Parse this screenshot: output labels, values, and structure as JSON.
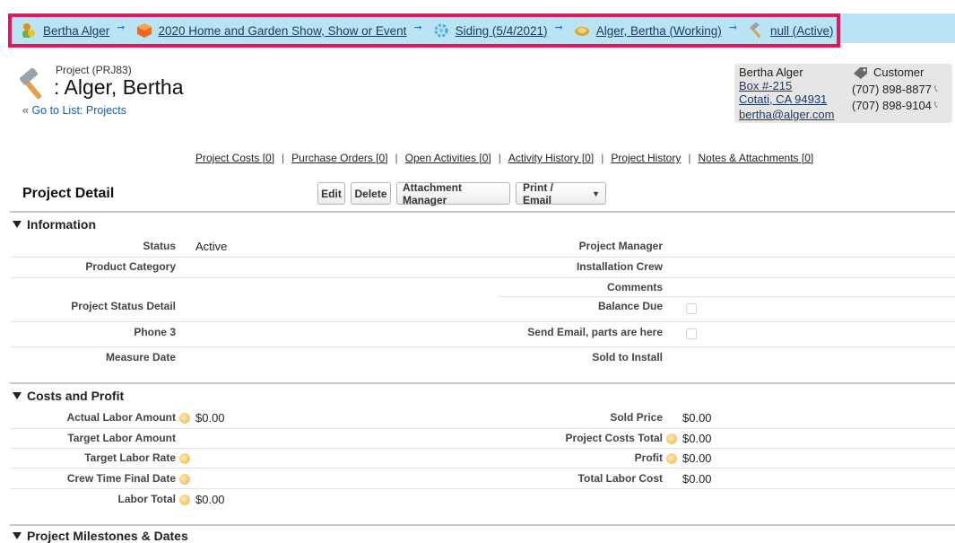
{
  "breadcrumbs": [
    {
      "label": "Bertha Alger",
      "icon": "contact-icon",
      "color": "#e88a1a"
    },
    {
      "label": "2020 Home and Garden Show, Show or Event",
      "icon": "box-icon",
      "color": "#f26b1d"
    },
    {
      "label": "Siding (5/4/2021)",
      "icon": "gear-icon",
      "color": "#48a8d8"
    },
    {
      "label": "Alger, Bertha (Working)",
      "icon": "handshake-icon",
      "color": "#e0a23a"
    },
    {
      "label": "null (Active)",
      "icon": "hammer-icon",
      "color": "#9aa3ab"
    }
  ],
  "header": {
    "project_type": "Project (PRJ83)",
    "title": ": Alger, Bertha",
    "goto_prefix": "« ",
    "goto_link": "Go to List: Projects"
  },
  "customer": {
    "name": "Bertha Alger",
    "address1": "Box #-215",
    "address2": "Cotati, CA 94931",
    "email": "bertha@alger.com",
    "type": "Customer",
    "phone1": "(707) 898-8877",
    "phone2": "(707) 898-9104"
  },
  "related_links": [
    "Project Costs [0]",
    "Purchase Orders [0]",
    "Open Activities [0]",
    "Activity History [0]",
    "Project History",
    "Notes & Attachments [0]"
  ],
  "detail": {
    "title": "Project Detail",
    "buttons": {
      "edit": "Edit",
      "delete": "Delete",
      "attachment": "Attachment Manager",
      "print": "Print / Email"
    }
  },
  "information": {
    "heading": "Information",
    "status_label": "Status",
    "status_value": "Active",
    "project_manager_label": "Project Manager",
    "product_category_label": "Product Category",
    "installation_crew_label": "Installation Crew",
    "comments_label": "Comments",
    "project_status_detail_label": "Project Status Detail",
    "balance_due_label": "Balance Due",
    "phone3_label": "Phone 3",
    "send_email_label": "Send Email, parts are here",
    "measure_date_label": "Measure Date",
    "sold_to_install_label": "Sold to Install"
  },
  "costs": {
    "heading": "Costs and Profit",
    "actual_labor_label": "Actual Labor Amount",
    "actual_labor_value": "$0.00",
    "sold_price_label": "Sold Price",
    "sold_price_value": "$0.00",
    "target_labor_amount_label": "Target Labor Amount",
    "project_costs_total_label": "Project Costs Total",
    "project_costs_total_value": "$0.00",
    "target_labor_rate_label": "Target Labor Rate",
    "profit_label": "Profit",
    "profit_value": "$0.00",
    "crew_time_label": "Crew Time Final Date",
    "total_labor_cost_label": "Total Labor Cost",
    "total_labor_cost_value": "$0.00",
    "labor_total_label": "Labor Total",
    "labor_total_value": "$0.00"
  },
  "next_section": {
    "heading": "Project Milestones & Dates"
  },
  "colors": {
    "highlight": "#e6155e",
    "crumb_bg": "#b9e4f4",
    "link": "#1a5ea5"
  }
}
